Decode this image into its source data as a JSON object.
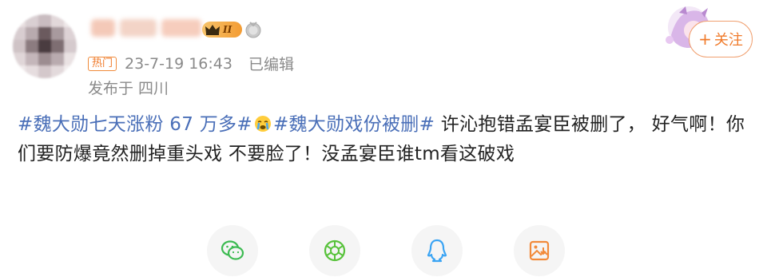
{
  "post": {
    "hot_tag": "热门",
    "timestamp": "23-7-19 16:43",
    "edited": "已编辑",
    "location": "发布于 四川",
    "level": "II",
    "follow_label": "关注",
    "follow_plus": "+",
    "text_segments": {
      "topic1": "#魏大勋七天涨粉 67 万多#",
      "topic2": "#魏大勋戏份被删#",
      "body": "  许沁抱错孟宴臣被删了，  好气啊！你们要防爆竟然删掉重头戏 不要脸了！没孟宴臣谁tm看这破戏"
    }
  },
  "icons": {
    "crown": "crown-icon",
    "medal": "medal-icon",
    "emoji": "crying-face-emoji-icon",
    "share": [
      "wechat-icon",
      "moments-icon",
      "qq-icon",
      "save-image-icon"
    ]
  },
  "colors": {
    "topic": "#4a6fb8",
    "accent": "#f07a2a",
    "meta": "#8a8a8a"
  }
}
